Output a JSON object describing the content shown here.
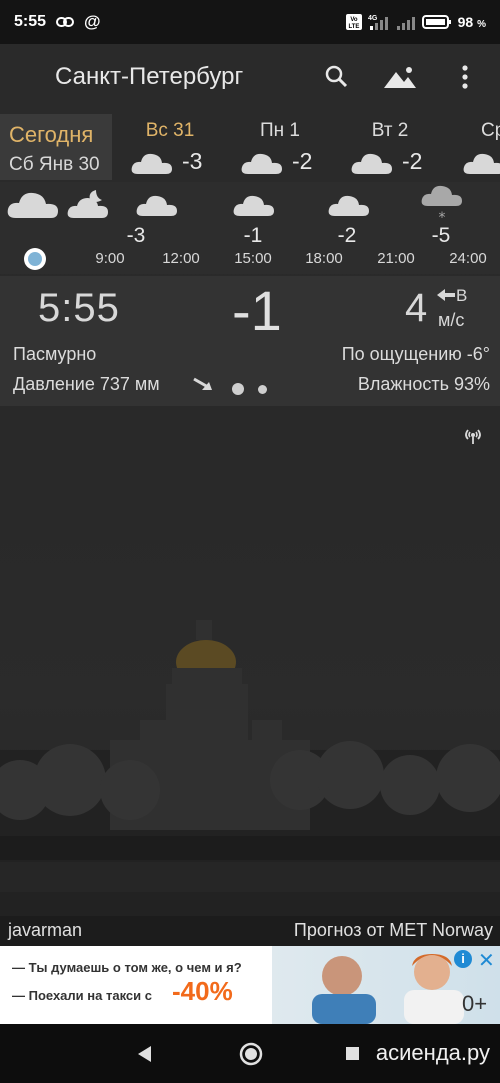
{
  "status": {
    "time": "5:55",
    "battery": "98",
    "battery_unit": "%",
    "network": "4G",
    "volte": "Vo LTE"
  },
  "header": {
    "city": "Санкт-Петербург"
  },
  "days": [
    {
      "name": "Сегодня",
      "date": "Сб Янв 30",
      "temp": "",
      "selected": true
    },
    {
      "name": "Вс 31",
      "temp": "-3",
      "highlight": true
    },
    {
      "name": "Пн 1",
      "temp": "-2"
    },
    {
      "name": "Вт 2",
      "temp": "-2"
    },
    {
      "name": "Ср",
      "temp": ""
    }
  ],
  "hourly": [
    {
      "time": "9:00",
      "temp": ""
    },
    {
      "time": "12:00",
      "temp": "-3"
    },
    {
      "time": "15:00",
      "temp": "-1"
    },
    {
      "time": "18:00",
      "temp": "-2"
    },
    {
      "time": "21:00",
      "temp": ""
    },
    {
      "time": "24:00",
      "temp": "-5"
    }
  ],
  "current": {
    "time": "5:55",
    "temp": "-1",
    "wind_speed": "4",
    "wind_dir": "В",
    "wind_unit": "м/с",
    "condition": "Пасмурно",
    "feels_like": "По ощущению -6°",
    "pressure": "Давление 737 мм",
    "humidity": "Влажность 93%"
  },
  "footer": {
    "author": "javarman",
    "source": "Прогноз от MET Norway"
  },
  "ad": {
    "line1": "— Ты думаешь о том же, о чем и я?",
    "line2": "— Поехали на такси с",
    "promo": "-40%",
    "age": "0+"
  },
  "watermark": "асиенда.ру",
  "colors": {
    "accent_gold": "#e0b468",
    "promo_orange": "#f26a1b",
    "info_blue": "#1f8ad4"
  }
}
